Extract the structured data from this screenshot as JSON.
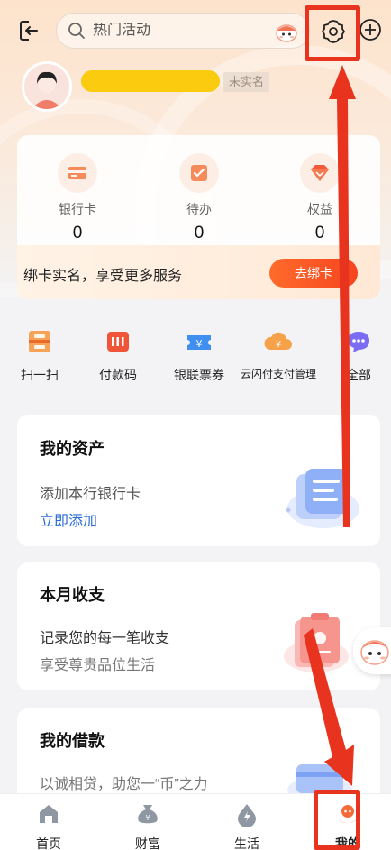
{
  "header": {
    "search_placeholder": "热门活动"
  },
  "profile": {
    "verify_status": "未实名"
  },
  "stats": [
    {
      "label": "银行卡",
      "value": "0",
      "icon": "bank-card-icon"
    },
    {
      "label": "待办",
      "value": "0",
      "icon": "todo-check-icon"
    },
    {
      "label": "权益",
      "value": "0",
      "icon": "diamond-icon"
    }
  ],
  "bind_banner": {
    "text": "绑卡实名，享受更多服务",
    "button": "去绑卡"
  },
  "quick_actions": [
    {
      "label": "扫一扫",
      "icon": "scan-icon"
    },
    {
      "label": "付款码",
      "icon": "payment-code-icon"
    },
    {
      "label": "银联票券",
      "icon": "ticket-icon"
    },
    {
      "label": "云闪付支付管理",
      "icon": "payment-manage-icon"
    },
    {
      "label": "全部",
      "icon": "more-icon"
    }
  ],
  "assets_card": {
    "title": "我的资产",
    "line1": "添加本行银行卡",
    "link": "立即添加"
  },
  "budget_card": {
    "title": "本月收支",
    "line1": "记录您的每一笔收支",
    "line2": "享受尊贵品位生活"
  },
  "loan_card": {
    "title": "我的借款",
    "line1": "以诚相贷，助您一“币”之力"
  },
  "tabs": [
    {
      "label": "首页",
      "icon": "home-icon"
    },
    {
      "label": "财富",
      "icon": "wealth-bag-icon"
    },
    {
      "label": "生活",
      "icon": "life-drop-icon"
    },
    {
      "label": "我的",
      "icon": "mine-mascot-icon"
    }
  ],
  "colors": {
    "accent": "#f6451f",
    "link": "#2a6bd6",
    "name_highlight": "#fbcb10",
    "annotation_red": "#e8331f"
  }
}
